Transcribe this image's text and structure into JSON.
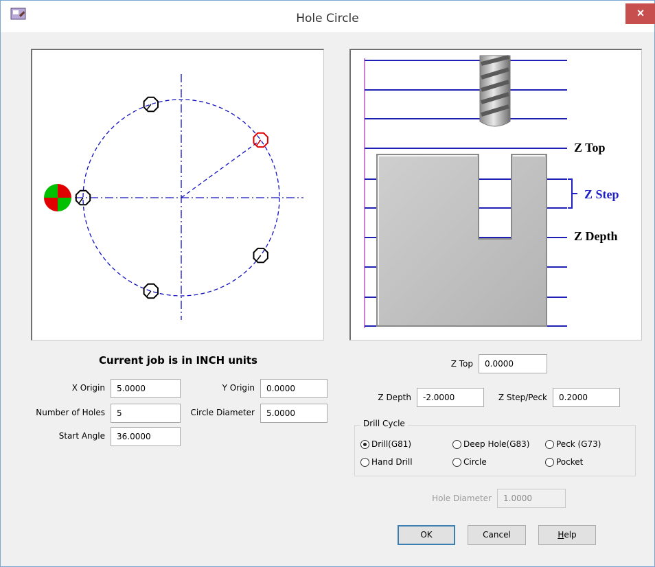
{
  "window": {
    "title": "Hole Circle",
    "close_glyph": "×",
    "app_icon": "app-icon"
  },
  "diagram_left": {
    "holes": [
      {
        "angle_deg": 36,
        "color": "#e00000"
      },
      {
        "angle_deg": 108,
        "color": "#000000"
      },
      {
        "angle_deg": 180,
        "color": "#000000"
      },
      {
        "angle_deg": 252,
        "color": "#000000"
      },
      {
        "angle_deg": 324,
        "color": "#000000"
      }
    ],
    "circle_color": "#1010c0",
    "origin_marker_colors": [
      "#00c000",
      "#e00000"
    ]
  },
  "diagram_right": {
    "labels": {
      "z_top": "Z Top",
      "z_step": "Z Step",
      "z_depth": "Z Depth"
    },
    "z_step_color": "#1f1fc8",
    "line_color": "#1e1eb4"
  },
  "units_heading": "Current job is in INCH units",
  "fields": {
    "x_origin": {
      "label": "X Origin",
      "value": "5.0000"
    },
    "y_origin": {
      "label": "Y Origin",
      "value": "0.0000"
    },
    "num_holes": {
      "label": "Number of Holes",
      "value": "5"
    },
    "circle_diameter": {
      "label": "Circle Diameter",
      "value": "5.0000"
    },
    "start_angle": {
      "label": "Start Angle",
      "value": "36.0000"
    },
    "z_top": {
      "label": "Z Top",
      "value": "0.0000"
    },
    "z_depth": {
      "label": "Z Depth",
      "value": "-2.0000"
    },
    "z_step_peck": {
      "label": "Z Step/Peck",
      "value": "0.2000"
    },
    "hole_diameter": {
      "label": "Hole Diameter",
      "value": "1.0000"
    }
  },
  "drill_cycle": {
    "title": "Drill Cycle",
    "options": [
      {
        "label": "Drill(G81)",
        "selected": true
      },
      {
        "label": "Deep Hole(G83)",
        "selected": false
      },
      {
        "label": "Peck (G73)",
        "selected": false
      },
      {
        "label": "Hand Drill",
        "selected": false
      },
      {
        "label": "Circle",
        "selected": false
      },
      {
        "label": "Pocket",
        "selected": false
      }
    ]
  },
  "buttons": {
    "ok": "OK",
    "cancel": "Cancel",
    "help_mnemonic": "H",
    "help_rest": "elp"
  }
}
